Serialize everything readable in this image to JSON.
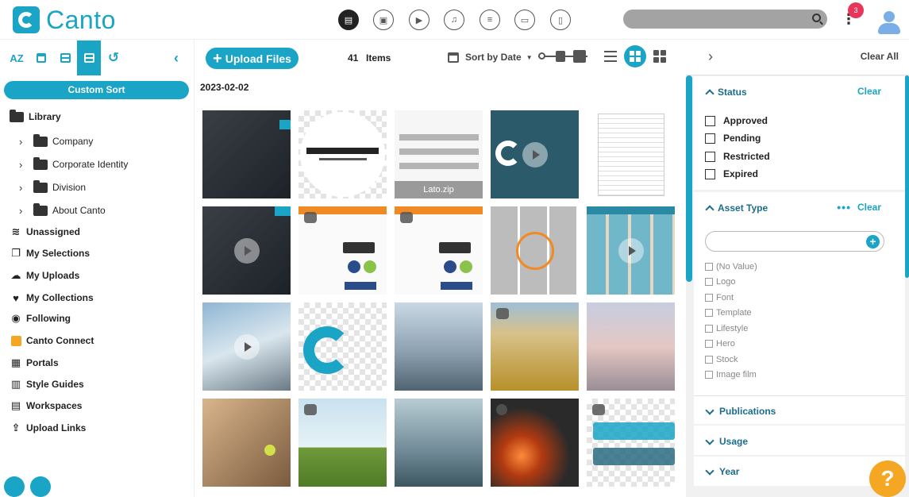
{
  "app": {
    "name": "Canto"
  },
  "topnav": {
    "icons": [
      "document-icon",
      "image-icon",
      "video-icon",
      "audio-icon",
      "text-doc-icon",
      "presentation-icon",
      "file-icon"
    ],
    "notification_count": "3"
  },
  "sidebar": {
    "tools": {
      "az": "AZ"
    },
    "custom_sort": "Custom Sort",
    "library": "Library",
    "folders": [
      {
        "label": "Company"
      },
      {
        "label": "Corporate Identity"
      },
      {
        "label": "Division"
      },
      {
        "label": "About Canto"
      }
    ],
    "nav": [
      {
        "label": "Unassigned"
      },
      {
        "label": "My Selections"
      },
      {
        "label": "My Uploads"
      },
      {
        "label": "My Collections"
      },
      {
        "label": "Following"
      },
      {
        "label": "Canto Connect"
      },
      {
        "label": "Portals"
      },
      {
        "label": "Style Guides"
      },
      {
        "label": "Workspaces"
      },
      {
        "label": "Upload Links"
      }
    ]
  },
  "main": {
    "upload_label": "Upload Files",
    "items_count": "41",
    "items_label": "Items",
    "sort_label": "Sort by Date",
    "date_heading": "2023-02-02",
    "thumbs": [
      {
        "label": ""
      },
      {
        "label": ""
      },
      {
        "label": "Lato.zip"
      },
      {
        "label": ""
      },
      {
        "label": ""
      }
    ]
  },
  "filters": {
    "clear_all": "Clear All",
    "status": {
      "title": "Status",
      "clear": "Clear",
      "options": [
        "Approved",
        "Pending",
        "Restricted",
        "Expired"
      ]
    },
    "asset_type": {
      "title": "Asset Type",
      "clear": "Clear",
      "more": "•••",
      "options": [
        "(No Value)",
        "Logo",
        "Font",
        "Template",
        "Lifestyle",
        "Hero",
        "Stock",
        "Image film"
      ]
    },
    "collapsed": [
      "Publications",
      "Usage",
      "Year"
    ]
  },
  "help_label": "?",
  "colors": {
    "brand": "#1aa4c6",
    "badge": "#e8365a",
    "help": "#f5a623"
  }
}
